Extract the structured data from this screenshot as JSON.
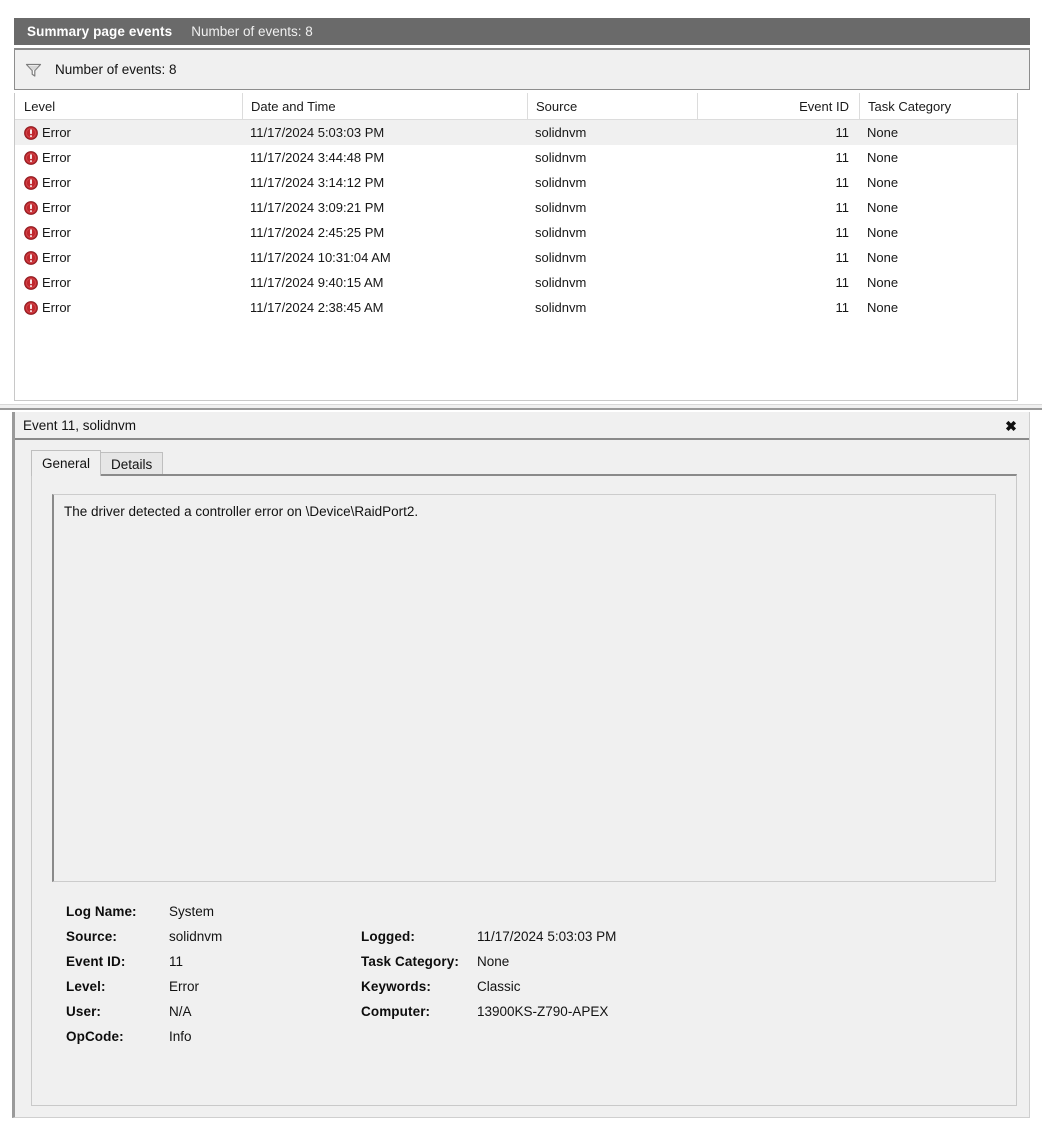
{
  "banner": {
    "title": "Summary page events",
    "subtitle": "Number of events: 8"
  },
  "filter_bar": {
    "icon": "funnel-filter-icon",
    "text": "Number of events: 8"
  },
  "event_list": {
    "columns": [
      {
        "key": "level",
        "label": "Level",
        "align": "left"
      },
      {
        "key": "datetime",
        "label": "Date and Time",
        "align": "left"
      },
      {
        "key": "source",
        "label": "Source",
        "align": "left"
      },
      {
        "key": "event_id",
        "label": "Event ID",
        "align": "right"
      },
      {
        "key": "task_category",
        "label": "Task Category",
        "align": "left"
      }
    ],
    "rows": [
      {
        "icon": "error-icon",
        "level": "Error",
        "datetime": "11/17/2024 5:03:03 PM",
        "source": "solidnvm",
        "event_id": "11",
        "task_category": "None",
        "selected": true
      },
      {
        "icon": "error-icon",
        "level": "Error",
        "datetime": "11/17/2024 3:44:48 PM",
        "source": "solidnvm",
        "event_id": "11",
        "task_category": "None",
        "selected": false
      },
      {
        "icon": "error-icon",
        "level": "Error",
        "datetime": "11/17/2024 3:14:12 PM",
        "source": "solidnvm",
        "event_id": "11",
        "task_category": "None",
        "selected": false
      },
      {
        "icon": "error-icon",
        "level": "Error",
        "datetime": "11/17/2024 3:09:21 PM",
        "source": "solidnvm",
        "event_id": "11",
        "task_category": "None",
        "selected": false
      },
      {
        "icon": "error-icon",
        "level": "Error",
        "datetime": "11/17/2024 2:45:25 PM",
        "source": "solidnvm",
        "event_id": "11",
        "task_category": "None",
        "selected": false
      },
      {
        "icon": "error-icon",
        "level": "Error",
        "datetime": "11/17/2024 10:31:04 AM",
        "source": "solidnvm",
        "event_id": "11",
        "task_category": "None",
        "selected": false
      },
      {
        "icon": "error-icon",
        "level": "Error",
        "datetime": "11/17/2024 9:40:15 AM",
        "source": "solidnvm",
        "event_id": "11",
        "task_category": "None",
        "selected": false
      },
      {
        "icon": "error-icon",
        "level": "Error",
        "datetime": "11/17/2024 2:38:45 AM",
        "source": "solidnvm",
        "event_id": "11",
        "task_category": "None",
        "selected": false
      }
    ]
  },
  "detail_pane": {
    "title": "Event 11, solidnvm",
    "close_label": "✖",
    "tabs": [
      {
        "label": "General",
        "active": true
      },
      {
        "label": "Details",
        "active": false
      }
    ],
    "description": "The driver detected a controller error on \\Device\\RaidPort2.",
    "metadata": [
      {
        "left_label": "Log Name:",
        "left_value": "System",
        "right_label": "",
        "right_value": ""
      },
      {
        "left_label": "Source:",
        "left_value": "solidnvm",
        "right_label": "Logged:",
        "right_value": "11/17/2024 5:03:03 PM"
      },
      {
        "left_label": "Event ID:",
        "left_value": "11",
        "right_label": "Task Category:",
        "right_value": "None"
      },
      {
        "left_label": "Level:",
        "left_value": "Error",
        "right_label": "Keywords:",
        "right_value": "Classic"
      },
      {
        "left_label": "User:",
        "left_value": "N/A",
        "right_label": "Computer:",
        "right_value": "13900KS-Z790-APEX"
      },
      {
        "left_label": "OpCode:",
        "left_value": "Info",
        "right_label": "",
        "right_value": ""
      }
    ]
  },
  "colors": {
    "banner_bg": "#6a6a6a",
    "panel_bg": "#f0f0f0",
    "error_red": "#c0272d",
    "selected_row": "#f0f0f0",
    "text": "#121212"
  }
}
